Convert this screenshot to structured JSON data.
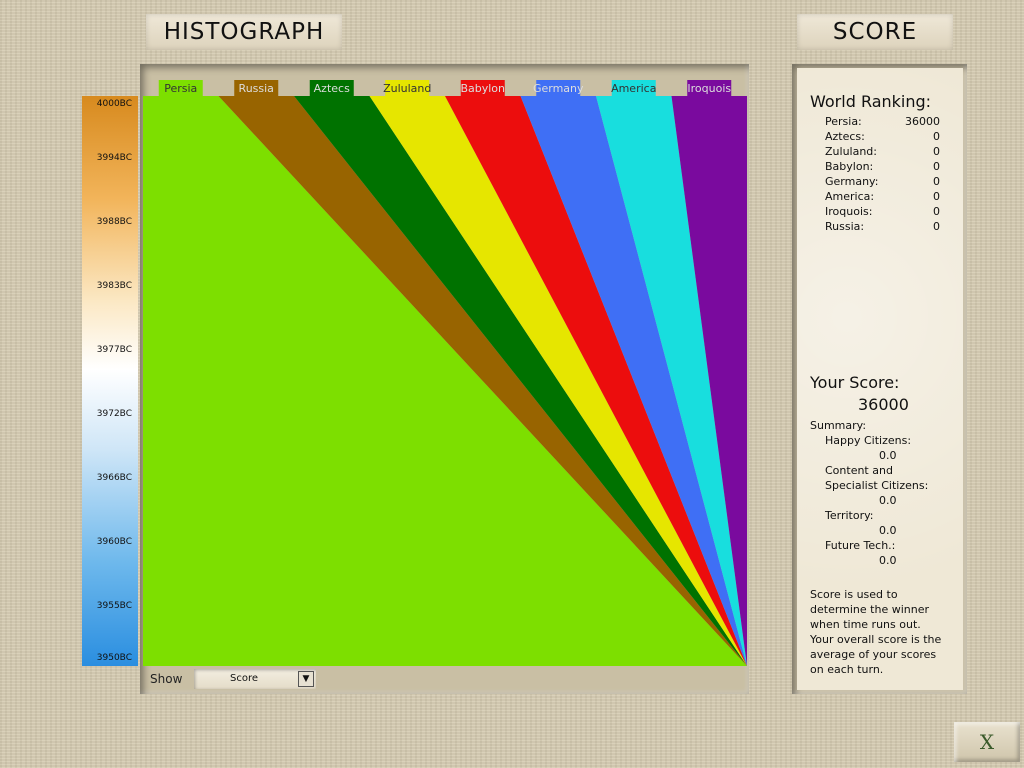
{
  "header": {
    "histograph_title": "HISTOGRAPH",
    "score_title": "SCORE"
  },
  "timeline": {
    "labels": [
      "4000BC",
      "3994BC",
      "3988BC",
      "3983BC",
      "3977BC",
      "3972BC",
      "3966BC",
      "3960BC",
      "3955BC",
      "3950BC"
    ]
  },
  "chart_data": {
    "type": "area",
    "stacked": true,
    "orientation": "horizontal",
    "categories": [
      "4000BC",
      "3994BC",
      "3988BC",
      "3983BC",
      "3977BC",
      "3972BC",
      "3966BC",
      "3960BC",
      "3955BC",
      "3950BC"
    ],
    "series": [
      {
        "name": "Persia",
        "color": "#7ddf00",
        "start": 0.125,
        "end": 1.0
      },
      {
        "name": "Russia",
        "color": "#986400",
        "start": 0.125,
        "end": 0.0
      },
      {
        "name": "Aztecs",
        "color": "#007200",
        "start": 0.125,
        "end": 0.0
      },
      {
        "name": "Zululand",
        "color": "#e6e600",
        "start": 0.125,
        "end": 0.0
      },
      {
        "name": "Babylon",
        "color": "#ec0d0d",
        "start": 0.125,
        "end": 0.0
      },
      {
        "name": "Germany",
        "color": "#3f6ff5",
        "start": 0.125,
        "end": 0.0
      },
      {
        "name": "America",
        "color": "#18dede",
        "start": 0.125,
        "end": 0.0
      },
      {
        "name": "Iroquois",
        "color": "#7a0a9e",
        "start": 0.125,
        "end": 0.0
      }
    ]
  },
  "controls": {
    "show_label": "Show",
    "show_value": "Score"
  },
  "score_panel": {
    "world_ranking_title": "World Ranking:",
    "ranking": [
      {
        "name": "Persia:",
        "score": "36000"
      },
      {
        "name": "Aztecs:",
        "score": "0"
      },
      {
        "name": "Zululand:",
        "score": "0"
      },
      {
        "name": "Babylon:",
        "score": "0"
      },
      {
        "name": "Germany:",
        "score": "0"
      },
      {
        "name": "America:",
        "score": "0"
      },
      {
        "name": "Iroquois:",
        "score": "0"
      },
      {
        "name": "Russia:",
        "score": "0"
      }
    ],
    "your_score_title": "Your Score:",
    "your_score_value": "36000",
    "summary_title": "Summary:",
    "summary": [
      {
        "label": "Happy Citizens:",
        "value": "0.0"
      },
      {
        "label": "Content and",
        "label2": "Specialist Citizens:",
        "value": "0.0"
      },
      {
        "label": "Territory:",
        "value": "0.0"
      },
      {
        "label": "Future Tech.:",
        "value": "0.0"
      }
    ],
    "note_lines": [
      "Score is used to",
      "determine the winner",
      "when time runs out.",
      "Your overall score is the",
      "average of your scores",
      "on each turn."
    ]
  },
  "close_label": "X"
}
